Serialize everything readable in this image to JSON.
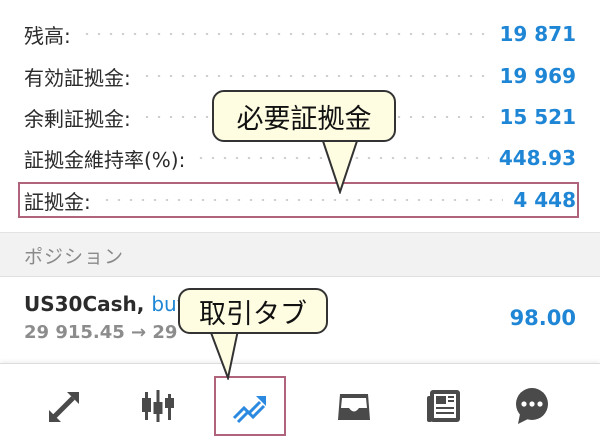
{
  "account": {
    "rows": [
      {
        "label": "残高:",
        "value": "19 871"
      },
      {
        "label": "有効証拠金:",
        "value": "19 969"
      },
      {
        "label": "余剰証拠金:",
        "value": "15 521"
      },
      {
        "label": "証拠金維持率(%):",
        "value": "448.93"
      },
      {
        "label": "証拠金:",
        "value": "4 448"
      }
    ]
  },
  "positions": {
    "header": "ポジション",
    "items": [
      {
        "symbol": "US30Cash,",
        "side": "buy",
        "prices": "29 915.45 → 29 ",
        "profit": "98.00"
      }
    ]
  },
  "annotations": {
    "margin_callout": "必要証拠金",
    "tab_callout": "取引タブ",
    "highlight_color": "#b0647c",
    "callout_bg": "#fffde1"
  },
  "tabbar": {
    "tabs": [
      {
        "icon": "quotes-arrows-icon",
        "active": false
      },
      {
        "icon": "chart-candles-icon",
        "active": false
      },
      {
        "icon": "trade-icon",
        "active": true
      },
      {
        "icon": "inbox-icon",
        "active": false
      },
      {
        "icon": "news-icon",
        "active": false
      },
      {
        "icon": "chat-icon",
        "active": false
      }
    ],
    "active_color": "#2b8ae0",
    "inactive_color": "#4a4a4a"
  }
}
